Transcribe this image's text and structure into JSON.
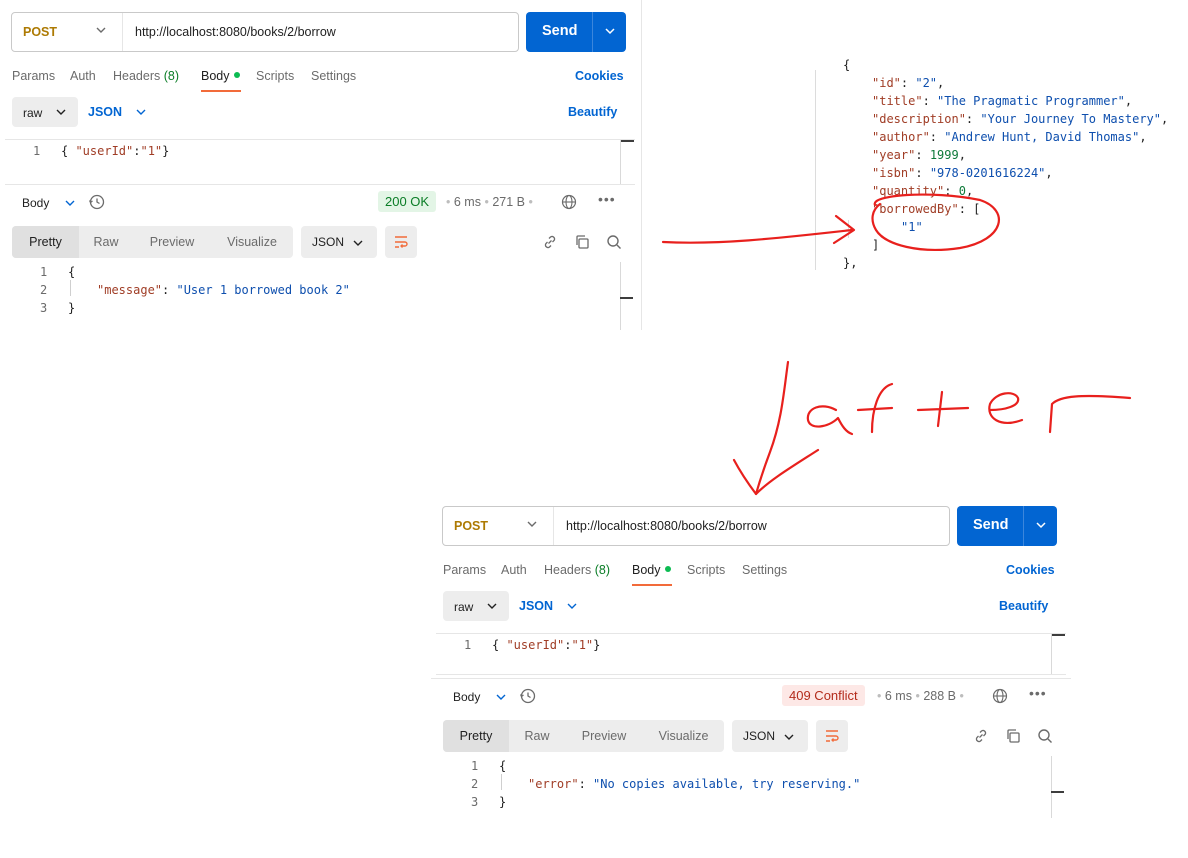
{
  "before": {
    "method": "POST",
    "url": "http://localhost:8080/books/2/borrow",
    "send_label": "Send",
    "tabs": {
      "params": "Params",
      "auth": "Auth",
      "headers": "Headers",
      "headers_count": "(8)",
      "body": "Body",
      "scripts": "Scripts",
      "settings": "Settings"
    },
    "cookies": "Cookies",
    "body_type": "raw",
    "body_format": "JSON",
    "beautify": "Beautify",
    "request_line_no": "1",
    "request_body": {
      "open": "{ ",
      "key": "\"userId\"",
      "colon": ":",
      "value": "\"1\"",
      "close": "}"
    },
    "response": {
      "label": "Body",
      "status": "200 OK",
      "time": "6 ms",
      "size": "271 B",
      "view_tabs": [
        "Pretty",
        "Raw",
        "Preview",
        "Visualize"
      ],
      "format": "JSON",
      "line_numbers": [
        "1",
        "2",
        "3"
      ],
      "open": "{",
      "key": "\"message\"",
      "value": "\"User 1 borrowed book 2\"",
      "close": "}"
    }
  },
  "book_json": {
    "open": "{",
    "lines": [
      {
        "key": "\"id\"",
        "value": "\"2\"",
        "type": "str",
        "end": ","
      },
      {
        "key": "\"title\"",
        "value": "\"The Pragmatic Programmer\"",
        "type": "str",
        "end": ","
      },
      {
        "key": "\"description\"",
        "value": "\"Your Journey To Mastery\"",
        "type": "str",
        "end": ","
      },
      {
        "key": "\"author\"",
        "value": "\"Andrew Hunt, David Thomas\"",
        "type": "str",
        "end": ","
      },
      {
        "key": "\"year\"",
        "value": "1999",
        "type": "num",
        "end": ","
      },
      {
        "key": "\"isbn\"",
        "value": "\"978-0201616224\"",
        "type": "str",
        "end": ","
      },
      {
        "key": "\"quantity\"",
        "value": "0",
        "type": "num",
        "end": ","
      },
      {
        "key": "\"borrowedBy\"",
        "value": "[",
        "type": "pun",
        "end": ""
      }
    ],
    "borrowed_item": "\"1\"",
    "array_close": "]",
    "close": "},"
  },
  "annotation": {
    "text": "after",
    "color": "#e8201d"
  },
  "after": {
    "method": "POST",
    "url": "http://localhost:8080/books/2/borrow",
    "send_label": "Send",
    "tabs": {
      "params": "Params",
      "auth": "Auth",
      "headers": "Headers",
      "headers_count": "(8)",
      "body": "Body",
      "scripts": "Scripts",
      "settings": "Settings"
    },
    "cookies": "Cookies",
    "body_type": "raw",
    "body_format": "JSON",
    "beautify": "Beautify",
    "request_line_no": "1",
    "request_body": {
      "open": "{ ",
      "key": "\"userId\"",
      "colon": ":",
      "value": "\"1\"",
      "close": "}"
    },
    "response": {
      "label": "Body",
      "status": "409 Conflict",
      "time": "6 ms",
      "size": "288 B",
      "view_tabs": [
        "Pretty",
        "Raw",
        "Preview",
        "Visualize"
      ],
      "format": "JSON",
      "line_numbers": [
        "1",
        "2",
        "3"
      ],
      "open": "{",
      "key": "\"error\"",
      "value": "\"No copies available, try reserving.\"",
      "close": "}"
    }
  },
  "colors": {
    "accent": "#0265d2",
    "method": "#ad7a03",
    "ok_bg": "#e3f5e6",
    "ok_fg": "#0a7d26",
    "err_bg": "#fde8e6",
    "err_fg": "#b32b1b",
    "tab_underline": "#f26b3a",
    "ink": "#e8201d"
  }
}
